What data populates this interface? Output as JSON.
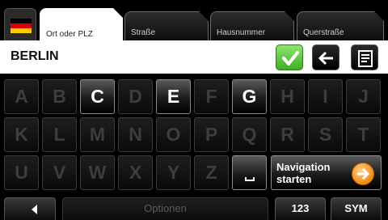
{
  "tabs": [
    {
      "label": "Ort oder PLZ",
      "active": true
    },
    {
      "label": "Straße",
      "active": false
    },
    {
      "label": "Hausnummer",
      "active": false
    },
    {
      "label": "Querstraße",
      "active": false
    }
  ],
  "country_flag": "germany-flag-icon",
  "input": {
    "value": "BERLIN"
  },
  "keyboard": {
    "rows": [
      [
        "A",
        "B",
        "C",
        "D",
        "E",
        "F",
        "G",
        "H",
        "I",
        "J"
      ],
      [
        "K",
        "L",
        "M",
        "N",
        "O",
        "P",
        "Q",
        "R",
        "S",
        "T"
      ],
      [
        "U",
        "V",
        "W",
        "X",
        "Y",
        "Z"
      ]
    ],
    "enabled_keys": [
      "C",
      "E",
      "G"
    ],
    "nav_button_label": "Navigation\nstarten"
  },
  "bottom": {
    "options_label": "Optionen",
    "numbers_label": "123",
    "symbols_label": "SYM"
  },
  "colors": {
    "accent_green": "#3fae27",
    "accent_orange": "#f08a10",
    "key_disabled_text": "#3d3d3d"
  }
}
